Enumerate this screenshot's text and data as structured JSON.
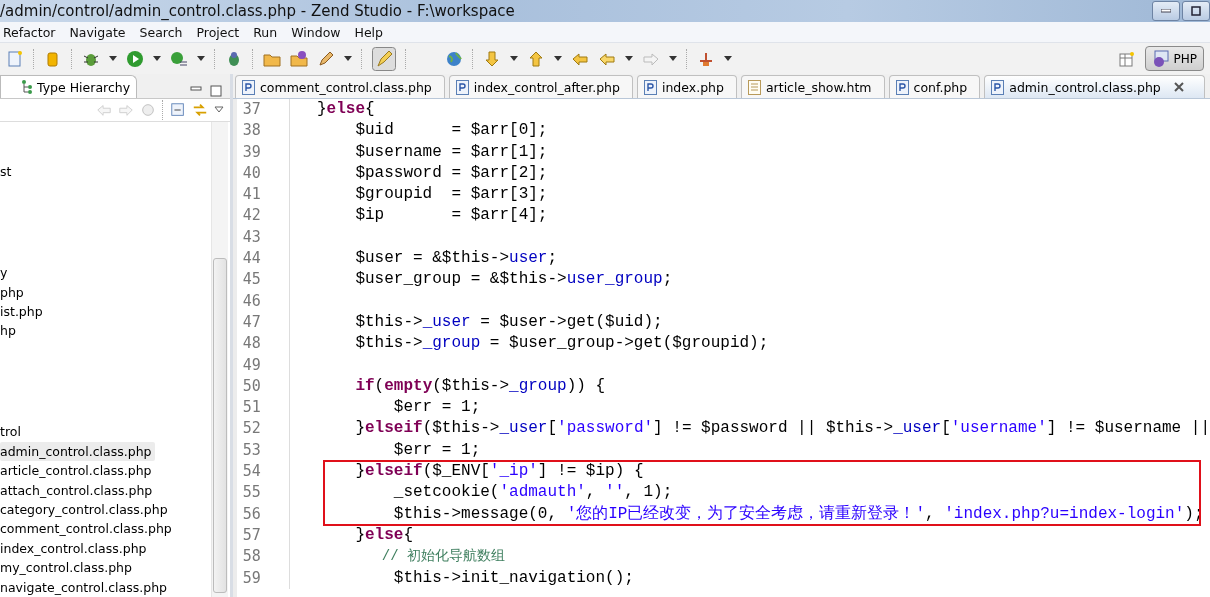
{
  "window": {
    "title": "/admin/control/admin_control.class.php - Zend Studio - F:\\workspace"
  },
  "menu": [
    "Refactor",
    "Navigate",
    "Search",
    "Project",
    "Run",
    "Window",
    "Help"
  ],
  "perspective": {
    "label": "PHP",
    "selected": true
  },
  "side_panel": {
    "tab": "Type Hierarchy",
    "tree_groups": [
      [
        {
          "label": "st",
          "selected": false
        }
      ],
      [
        {
          "label": "y",
          "selected": false
        },
        {
          "label": "php",
          "selected": false
        },
        {
          "label": "ist.php",
          "selected": false
        },
        {
          "label": "hp",
          "selected": false
        }
      ],
      [
        {
          "label": "trol",
          "selected": false
        },
        {
          "label": "admin_control.class.php",
          "selected": true
        },
        {
          "label": "article_control.class.php",
          "selected": false
        },
        {
          "label": "attach_control.class.php",
          "selected": false
        },
        {
          "label": "category_control.class.php",
          "selected": false
        },
        {
          "label": "comment_control.class.php",
          "selected": false
        },
        {
          "label": "index_control.class.php",
          "selected": false
        },
        {
          "label": "my_control.class.php",
          "selected": false
        },
        {
          "label": "navigate_control.class.php",
          "selected": false
        }
      ]
    ]
  },
  "editor_tabs": [
    {
      "label": "comment_control.class.php",
      "kind": "php",
      "selected": false
    },
    {
      "label": "index_control_after.php",
      "kind": "php",
      "selected": false
    },
    {
      "label": "index.php",
      "kind": "php",
      "selected": false
    },
    {
      "label": "article_show.htm",
      "kind": "html",
      "selected": false
    },
    {
      "label": "conf.php",
      "kind": "php",
      "selected": false
    },
    {
      "label": "admin_control.class.php",
      "kind": "php",
      "selected": true
    }
  ],
  "code_lines": [
    {
      "number": "37",
      "boxed": false,
      "tokens": [
        {
          "kind": "plain",
          "text": "  }"
        },
        {
          "kind": "keyword",
          "text": "else"
        },
        {
          "kind": "plain",
          "text": "{"
        }
      ]
    },
    {
      "number": "38",
      "boxed": false,
      "tokens": [
        {
          "kind": "plain",
          "text": "      $uid      = $arr[0];"
        }
      ]
    },
    {
      "number": "39",
      "boxed": false,
      "tokens": [
        {
          "kind": "plain",
          "text": "      $username = $arr[1];"
        }
      ]
    },
    {
      "number": "40",
      "boxed": false,
      "tokens": [
        {
          "kind": "plain",
          "text": "      $password = $arr[2];"
        }
      ]
    },
    {
      "number": "41",
      "boxed": false,
      "tokens": [
        {
          "kind": "plain",
          "text": "      $groupid  = $arr[3];"
        }
      ]
    },
    {
      "number": "42",
      "boxed": false,
      "tokens": [
        {
          "kind": "plain",
          "text": "      $ip       = $arr[4];"
        }
      ]
    },
    {
      "number": "43",
      "boxed": false
    },
    {
      "number": "44",
      "boxed": false,
      "tokens": [
        {
          "kind": "plain",
          "text": "      $user = &$this->"
        },
        {
          "kind": "field",
          "text": "user"
        },
        {
          "kind": "plain",
          "text": ";"
        }
      ]
    },
    {
      "number": "45",
      "boxed": false,
      "tokens": [
        {
          "kind": "plain",
          "text": "      $user_group = &$this->"
        },
        {
          "kind": "field",
          "text": "user_group"
        },
        {
          "kind": "plain",
          "text": ";"
        }
      ]
    },
    {
      "number": "46",
      "boxed": false
    },
    {
      "number": "47",
      "boxed": false,
      "tokens": [
        {
          "kind": "plain",
          "text": "      $this->"
        },
        {
          "kind": "field",
          "text": "_user"
        },
        {
          "kind": "plain",
          "text": " = $user->get($uid);"
        }
      ]
    },
    {
      "number": "48",
      "boxed": false,
      "tokens": [
        {
          "kind": "plain",
          "text": "      $this->"
        },
        {
          "kind": "field",
          "text": "_group"
        },
        {
          "kind": "plain",
          "text": " = $user_group->get($groupid);"
        }
      ]
    },
    {
      "number": "49",
      "boxed": false
    },
    {
      "number": "50",
      "boxed": false,
      "tokens": [
        {
          "kind": "keyword",
          "text": "      if"
        },
        {
          "kind": "plain",
          "text": "("
        },
        {
          "kind": "keyword",
          "text": "empty"
        },
        {
          "kind": "plain",
          "text": "($this->"
        },
        {
          "kind": "field",
          "text": "_group"
        },
        {
          "kind": "plain",
          "text": ")) {"
        }
      ]
    },
    {
      "number": "51",
      "boxed": false,
      "tokens": [
        {
          "kind": "plain",
          "text": "          $err = 1;"
        }
      ]
    },
    {
      "number": "52",
      "boxed": false,
      "tokens": [
        {
          "kind": "plain",
          "text": "      }"
        },
        {
          "kind": "keyword",
          "text": "elseif"
        },
        {
          "kind": "plain",
          "text": "($this->"
        },
        {
          "kind": "field",
          "text": "_user"
        },
        {
          "kind": "plain",
          "text": "["
        },
        {
          "kind": "string",
          "text": "'password'"
        },
        {
          "kind": "plain",
          "text": "] != $password || $this->"
        },
        {
          "kind": "field",
          "text": "_user"
        },
        {
          "kind": "plain",
          "text": "["
        },
        {
          "kind": "string",
          "text": "'username'"
        },
        {
          "kind": "plain",
          "text": "] != $username ||"
        }
      ]
    },
    {
      "number": "53",
      "boxed": false,
      "tokens": [
        {
          "kind": "plain",
          "text": "          $err = 1;"
        }
      ]
    },
    {
      "number": "54",
      "boxed": true,
      "tokens": [
        {
          "kind": "plain",
          "text": "      }"
        },
        {
          "kind": "keyword",
          "text": "elseif"
        },
        {
          "kind": "plain",
          "text": "($_ENV["
        },
        {
          "kind": "string",
          "text": "'_ip'"
        },
        {
          "kind": "plain",
          "text": "] != $ip) {"
        }
      ]
    },
    {
      "number": "55",
      "boxed": true,
      "tokens": [
        {
          "kind": "plain",
          "text": "          _setcookie("
        },
        {
          "kind": "string",
          "text": "'admauth'"
        },
        {
          "kind": "plain",
          "text": ", "
        },
        {
          "kind": "string",
          "text": "''"
        },
        {
          "kind": "plain",
          "text": ", 1);"
        }
      ]
    },
    {
      "number": "56",
      "boxed": true,
      "tokens": [
        {
          "kind": "plain",
          "text": "          $this->message(0, "
        },
        {
          "kind": "string",
          "text": "'您的IP已经改变，为了安全考虑，请重新登录！'"
        },
        {
          "kind": "plain",
          "text": ", "
        },
        {
          "kind": "string",
          "text": "'index.php?u=index-login'"
        },
        {
          "kind": "plain",
          "text": ");"
        }
      ]
    },
    {
      "number": "57",
      "boxed": false,
      "tokens": [
        {
          "kind": "plain",
          "text": "      }"
        },
        {
          "kind": "keyword",
          "text": "else"
        },
        {
          "kind": "plain",
          "text": "{"
        }
      ]
    },
    {
      "number": "58",
      "boxed": false,
      "tokens": [
        {
          "kind": "comment",
          "text": "          // 初始化导航数组"
        }
      ]
    },
    {
      "number": "59",
      "boxed": false,
      "tokens": [
        {
          "kind": "plain",
          "text": "          $this->init_navigation();"
        }
      ]
    }
  ]
}
